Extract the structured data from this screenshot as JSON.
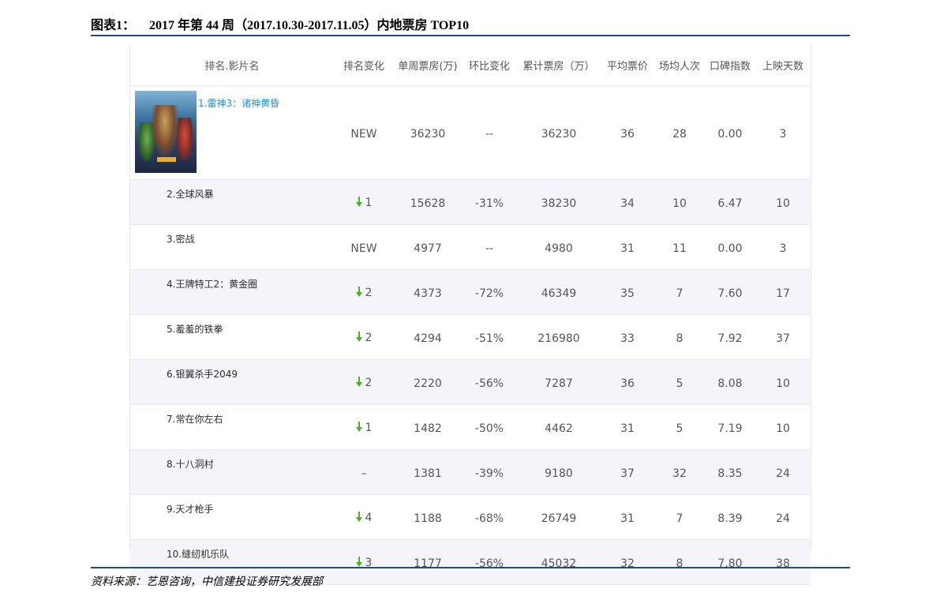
{
  "figure": {
    "label": "图表1：",
    "title": "2017 年第 44 周（2017.10.30-2017.11.05）内地票房 TOP10"
  },
  "source": "资料来源：艺恩咨询，中信建投证券研究发展部",
  "colors": {
    "rule": "#1f4e79",
    "link": "#1e90d6",
    "arrow_down": "#4caf27",
    "alt_row": "#f5f4fa"
  },
  "table": {
    "headers": [
      "排名.影片名",
      "排名变化",
      "单周票房(万)",
      "环比变化",
      "累计票房（万）",
      "平均票价",
      "场均人次",
      "口碑指数",
      "上映天数"
    ],
    "rows": [
      {
        "name": "1.雷神3：诸神黄昏",
        "change": "NEW",
        "weekly": "36230",
        "wow": "--",
        "total": "36230",
        "price": "36",
        "per_show": "28",
        "score": "0.00",
        "days": "3"
      },
      {
        "name": "2.全球风暴",
        "arrow": "down",
        "change": "1",
        "weekly": "15628",
        "wow": "-31%",
        "total": "38230",
        "price": "34",
        "per_show": "10",
        "score": "6.47",
        "days": "10"
      },
      {
        "name": "3.密战",
        "change": "NEW",
        "weekly": "4977",
        "wow": "--",
        "total": "4980",
        "price": "31",
        "per_show": "11",
        "score": "0.00",
        "days": "3"
      },
      {
        "name": "4.王牌特工2：黄金圈",
        "arrow": "down",
        "change": "2",
        "weekly": "4373",
        "wow": "-72%",
        "total": "46349",
        "price": "35",
        "per_show": "7",
        "score": "7.60",
        "days": "17"
      },
      {
        "name": "5.羞羞的铁拳",
        "arrow": "down",
        "change": "2",
        "weekly": "4294",
        "wow": "-51%",
        "total": "216980",
        "price": "33",
        "per_show": "8",
        "score": "7.92",
        "days": "37"
      },
      {
        "name": "6.银翼杀手2049",
        "arrow": "down",
        "change": "2",
        "weekly": "2220",
        "wow": "-56%",
        "total": "7287",
        "price": "36",
        "per_show": "5",
        "score": "8.08",
        "days": "10"
      },
      {
        "name": "7.常在你左右",
        "arrow": "down",
        "change": "1",
        "weekly": "1482",
        "wow": "-50%",
        "total": "4462",
        "price": "31",
        "per_show": "5",
        "score": "7.19",
        "days": "10"
      },
      {
        "name": "8.十八洞村",
        "change": "–",
        "weekly": "1381",
        "wow": "-39%",
        "total": "9180",
        "price": "37",
        "per_show": "32",
        "score": "8.35",
        "days": "24"
      },
      {
        "name": "9.天才枪手",
        "arrow": "down",
        "change": "4",
        "weekly": "1188",
        "wow": "-68%",
        "total": "26749",
        "price": "31",
        "per_show": "7",
        "score": "8.39",
        "days": "24"
      },
      {
        "name": "10.缝纫机乐队",
        "arrow": "down",
        "change": "3",
        "weekly": "1177",
        "wow": "-56%",
        "total": "45032",
        "price": "32",
        "per_show": "8",
        "score": "7.80",
        "days": "38"
      }
    ]
  }
}
